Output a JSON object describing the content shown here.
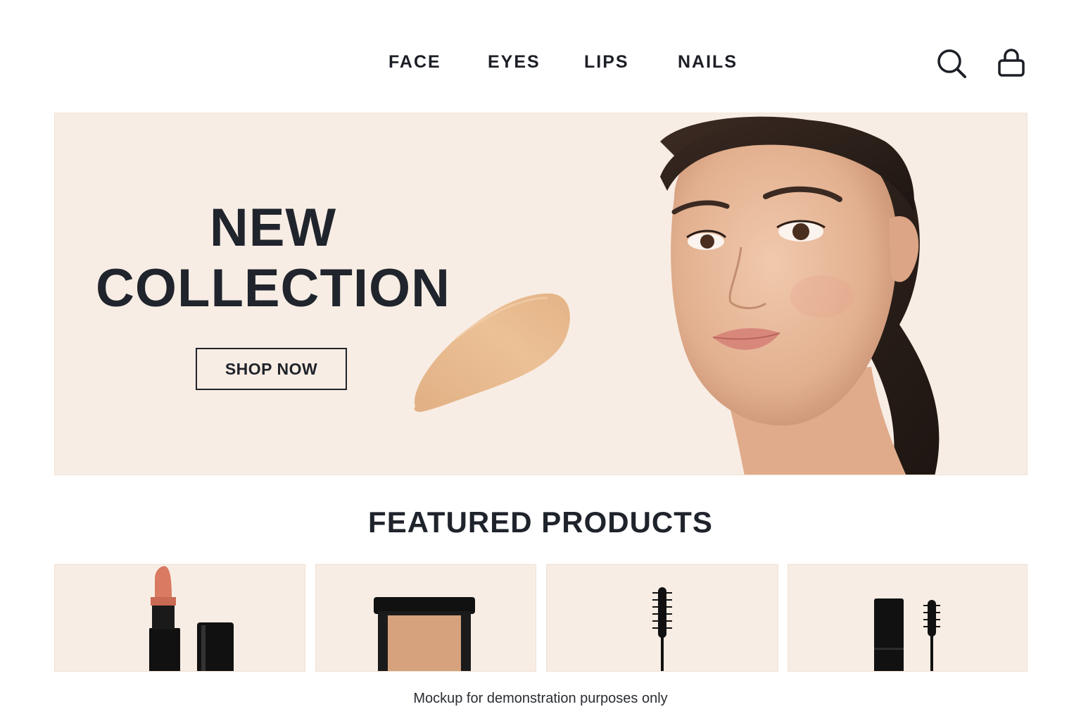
{
  "nav": {
    "items": [
      {
        "label": "FACE"
      },
      {
        "label": "EYES"
      },
      {
        "label": "LIPS"
      },
      {
        "label": "NAILS"
      }
    ],
    "icons": {
      "search": "search-icon",
      "bag": "shopping-bag-icon"
    }
  },
  "hero": {
    "title_line1": "NEW",
    "title_line2": "COLLECTION",
    "cta_label": "SHOP NOW",
    "background_color": "#f8ede4"
  },
  "featured": {
    "title": "FEATURED PRODUCTS",
    "products": [
      {
        "image": "lipstick"
      },
      {
        "image": "foundation-compact"
      },
      {
        "image": "mascara-wand"
      },
      {
        "image": "mascara-tube-and-wand"
      }
    ]
  },
  "footer": {
    "note": "Mockup for demonstration purposes only"
  },
  "colors": {
    "text": "#1f232b",
    "accent_bg": "#f8ede4",
    "swatch": "#e7b88c",
    "lipstick": "#d97a62"
  }
}
